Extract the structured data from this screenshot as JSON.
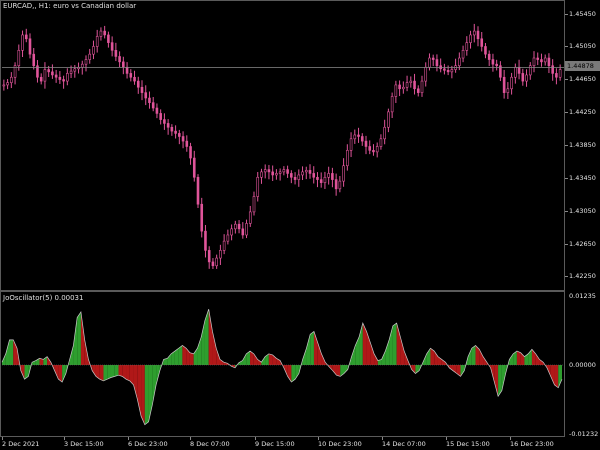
{
  "symbol_header": "EURCAD,, H1:  euro vs Canadian dollar",
  "indicator_header": "JoOscillator(5) 0.00031",
  "current_price": "1.44878",
  "price_axis": [
    "1.45450",
    "1.45050",
    "1.44650",
    "1.44250",
    "1.43850",
    "1.43450",
    "1.43050",
    "1.42650",
    "1.42250"
  ],
  "osc_axis": [
    "0.01235",
    "0.00000",
    "-0.01232"
  ],
  "time_axis": [
    "2 Dec 2021",
    "3 Dec 15:00",
    "6 Dec 23:00",
    "8 Dec 07:00",
    "9 Dec 15:00",
    "10 Dec 23:00",
    "14 Dec 07:00",
    "15 Dec 15:00",
    "16 Dec 23:00"
  ],
  "colors": {
    "background": "#000000",
    "candle": "#e0559a",
    "osc_up": "#2e9e2e",
    "osc_down": "#b01818",
    "osc_line": "#c8c8c8",
    "grid": "#5a5a5a"
  },
  "chart_data": {
    "type": "candlestick+histogram",
    "price_ylim": [
      1.4205,
      1.4565
    ],
    "price_path": [
      1.4465,
      1.4468,
      1.4475,
      1.449,
      1.451,
      1.453,
      1.4525,
      1.4505,
      1.449,
      1.4475,
      1.447,
      1.4485,
      1.4482,
      1.4478,
      1.4475,
      1.4472,
      1.447,
      1.448,
      1.4483,
      1.4486,
      1.4488,
      1.4492,
      1.4498,
      1.4505,
      1.4515,
      1.4528,
      1.4535,
      1.453,
      1.452,
      1.451,
      1.4502,
      1.4495,
      1.4488,
      1.448,
      1.4475,
      1.447,
      1.4462,
      1.4455,
      1.4448,
      1.4442,
      1.4435,
      1.4428,
      1.442,
      1.4415,
      1.441,
      1.4405,
      1.4402,
      1.4398,
      1.4392,
      1.4385,
      1.437,
      1.4345,
      1.431,
      1.4275,
      1.425,
      1.4235,
      1.423,
      1.424,
      1.425,
      1.4262,
      1.427,
      1.4278,
      1.4284,
      1.4278,
      1.427,
      1.4285,
      1.43,
      1.432,
      1.4345,
      1.4352,
      1.4355,
      1.4352,
      1.4348,
      1.435,
      1.4352,
      1.4355,
      1.435,
      1.4345,
      1.4342,
      1.4348,
      1.4352,
      1.4354,
      1.435,
      1.4345,
      1.4342,
      1.4338,
      1.4345,
      1.435,
      1.4342,
      1.433,
      1.434,
      1.436,
      1.438,
      1.4395,
      1.44,
      1.4398,
      1.4392,
      1.4385,
      1.438,
      1.4378,
      1.4385,
      1.4395,
      1.441,
      1.443,
      1.445,
      1.4465,
      1.446,
      1.4462,
      1.4468,
      1.447,
      1.446,
      1.4455,
      1.447,
      1.4488,
      1.45,
      1.4498,
      1.449,
      1.4486,
      1.4484,
      1.4482,
      1.4485,
      1.449,
      1.45,
      1.451,
      1.452,
      1.453,
      1.4535,
      1.4525,
      1.4515,
      1.4505,
      1.4498,
      1.4492,
      1.449,
      1.4475,
      1.4455,
      1.446,
      1.4475,
      1.4488,
      1.448,
      1.447,
      1.4478,
      1.449,
      1.45,
      1.4498,
      1.4495,
      1.45,
      1.449,
      1.448,
      1.4475,
      1.4485
    ],
    "osc_ylim": [
      -0.01232,
      0.01235
    ],
    "osc_values": [
      0.0005,
      0.002,
      0.0045,
      0.0045,
      0.003,
      -0.001,
      -0.0025,
      -0.002,
      0.0005,
      0.0008,
      0.0012,
      0.001,
      0.0015,
      0.0005,
      -0.001,
      -0.0025,
      -0.003,
      -0.0015,
      0.001,
      0.0035,
      0.0085,
      0.0095,
      0.0045,
      0.001,
      -0.001,
      -0.002,
      -0.0025,
      -0.0028,
      -0.0025,
      -0.0022,
      -0.002,
      -0.0018,
      -0.002,
      -0.0025,
      -0.0028,
      -0.0035,
      -0.006,
      -0.009,
      -0.0105,
      -0.01,
      -0.007,
      -0.0035,
      -0.001,
      0.001,
      0.0012,
      0.002,
      0.0025,
      0.003,
      0.0035,
      0.003,
      0.0022,
      0.002,
      0.003,
      0.005,
      0.008,
      0.01,
      0.006,
      0.003,
      0.001,
      0.0005,
      0.0003,
      -0.0002,
      -0.0005,
      0.0004,
      0.0008,
      0.002,
      0.0025,
      0.002,
      0.001,
      0.0005,
      0.0015,
      0.002,
      0.0018,
      0.0012,
      0.0008,
      -0.0005,
      -0.002,
      -0.003,
      -0.0025,
      -0.0015,
      0.001,
      0.003,
      0.0055,
      0.006,
      0.004,
      0.002,
      0.0005,
      -0.0003,
      -0.001,
      -0.0018,
      -0.002,
      -0.0015,
      -0.0008,
      0.0015,
      0.0035,
      0.005,
      0.0075,
      0.006,
      0.004,
      0.002,
      0.0008,
      0.001,
      0.0025,
      0.0045,
      0.007,
      0.0075,
      0.005,
      0.0025,
      0.0008,
      -0.0008,
      -0.0015,
      -0.001,
      0.0005,
      0.002,
      0.003,
      0.0025,
      0.0015,
      0.001,
      0.0005,
      -0.0005,
      -0.001,
      -0.0015,
      -0.002,
      -0.001,
      0.0015,
      0.003,
      0.0035,
      0.0028,
      0.0015,
      0.0005,
      -0.0005,
      -0.003,
      -0.0055,
      -0.0045,
      -0.0015,
      0.001,
      0.002,
      0.0025,
      0.0022,
      0.0015,
      0.002,
      0.0028,
      0.002,
      0.001,
      0.0005,
      -0.0005,
      -0.002,
      -0.0035,
      -0.004,
      -0.0025
    ]
  }
}
